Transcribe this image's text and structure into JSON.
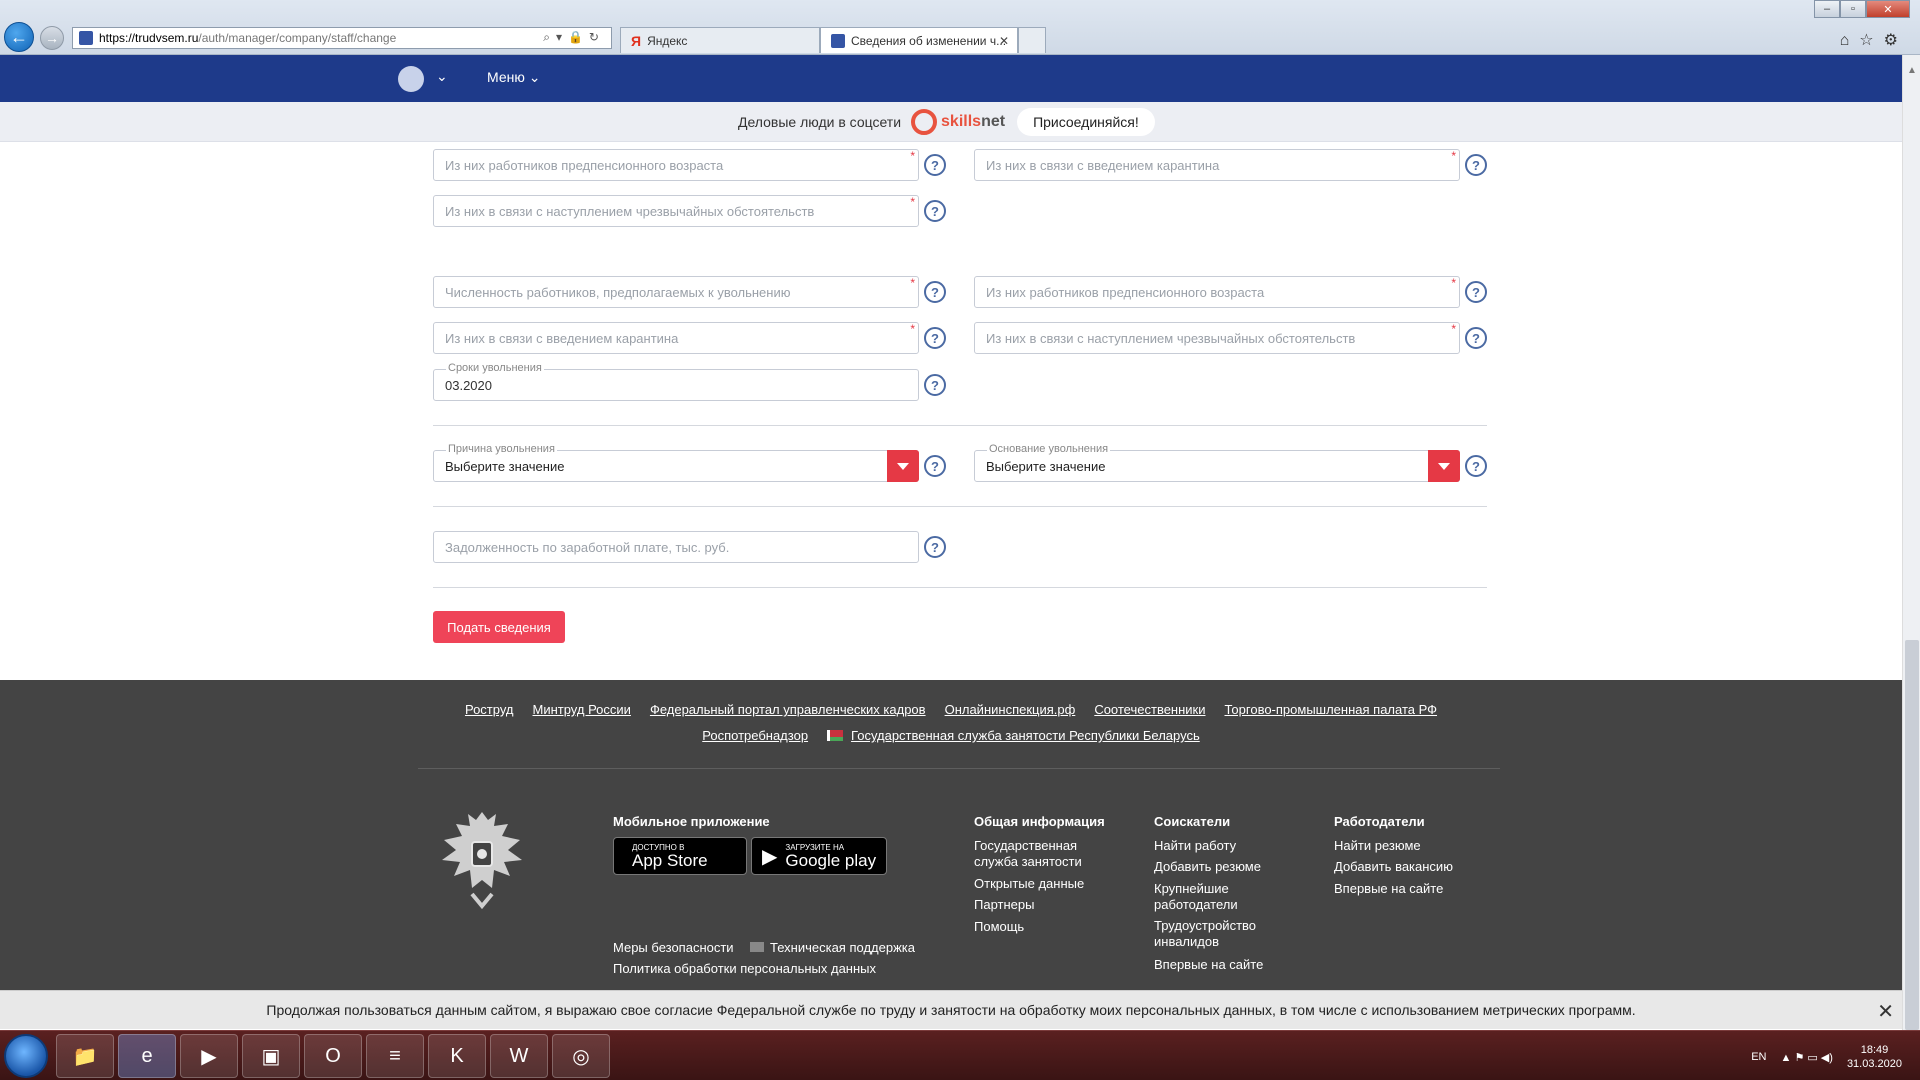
{
  "browser": {
    "url_host": "https://trudvsem.ru",
    "url_path": "/auth/manager/company/staff/change",
    "tabs": [
      {
        "label": "Яндекс"
      },
      {
        "label": "Сведения об изменении ч..."
      }
    ]
  },
  "header": {
    "menu_label": "Меню"
  },
  "promo": {
    "text": "Деловые люди в соцсети",
    "brand_part1": "skills",
    "brand_part2": "net",
    "join_label": "Присоединяйся!"
  },
  "form": {
    "fields": {
      "pre_pension_1": "Из них работников предпенсионного возраста",
      "quarantine_1": "Из них в связи с введением карантина",
      "emergency_1": "Из них в связи с наступлением чрезвычайных обстоятельств",
      "dismiss_count": "Численность работников, предполагаемых к увольнению",
      "pre_pension_2": "Из них работников предпенсионного возраста",
      "quarantine_2": "Из них в связи с введением карантина",
      "emergency_2": "Из них в связи с наступлением чрезвычайных обстоятельств",
      "dismiss_date_label": "Сроки увольнения",
      "dismiss_date_value": "03.2020",
      "reason_label": "Причина увольнения",
      "reason_value": "Выберите значение",
      "basis_label": "Основание увольнения",
      "basis_value": "Выберите значение",
      "wage_debt": "Задолженность по заработной плате, тыс. руб."
    },
    "help_symbol": "?",
    "submit_label": "Подать сведения"
  },
  "footer": {
    "links_row1": [
      "Роструд",
      "Минтруд России",
      "Федеральный портал управленческих кадров",
      "Онлайнинспекция.рф",
      "Соотечественники",
      "Торгово-промышленная палата РФ"
    ],
    "links_row2": [
      "Роспотребнадзор",
      "Государственная служба занятости Республики Беларусь"
    ],
    "mobile_title": "Мобильное приложение",
    "appstore_small": "Доступно в",
    "appstore_big": "App Store",
    "googleplay_small": "Загрузите на",
    "googleplay_big": "Google play",
    "security_label": "Меры безопасности",
    "support_label": "Техническая поддержка",
    "privacy_label": "Политика обработки персональных данных",
    "columns": [
      {
        "title": "Общая информация",
        "items": [
          "Государственная служба занятости",
          "Открытые данные",
          "Партнеры",
          "Помощь"
        ]
      },
      {
        "title": "Соискатели",
        "items": [
          "Найти работу",
          "Добавить резюме",
          "Крупнейшие работодатели",
          "Трудоустройство инвалидов",
          "Впервые на сайте"
        ]
      },
      {
        "title": "Работодатели",
        "items": [
          "Найти резюме",
          "Добавить вакансию",
          "Впервые на сайте"
        ]
      }
    ]
  },
  "cookie": {
    "text": "Продолжая пользоваться данным сайтом, я выражаю свое согласие Федеральной службе по труду и занятости на обработку моих персональных данных, в том числе с использованием метрических программ.",
    "close": "✕"
  },
  "taskbar": {
    "lang": "EN",
    "time": "18:49",
    "date": "31.03.2020"
  },
  "colors": {
    "header_blue": "#1e3a8a",
    "accent_red": "#ef4458",
    "footer_bg": "#444444"
  }
}
